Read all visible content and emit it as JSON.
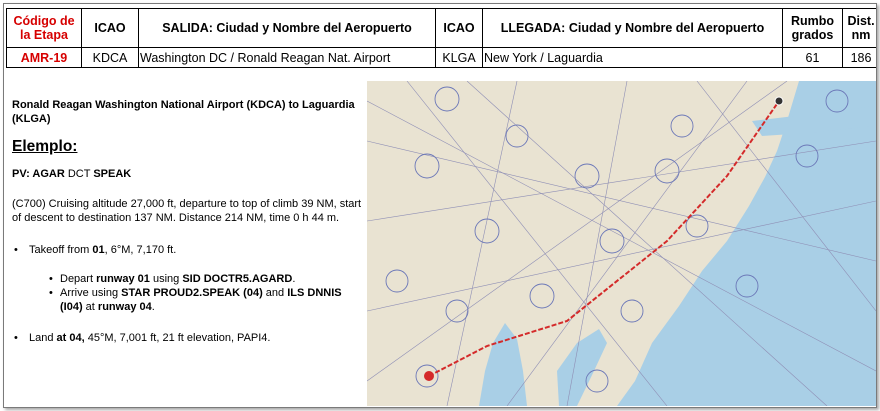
{
  "table": {
    "headers": {
      "code": "Código de la Etapa",
      "icao_dep": "ICAO",
      "departure": "SALIDA: Ciudad y Nombre del Aeropuerto",
      "icao_arr": "ICAO",
      "arrival": "LLEGADA: Ciudad y Nombre del Aeropuerto",
      "heading": "Rumbo grados",
      "distance": "Dist. nm"
    },
    "row": {
      "code": "AMR-19",
      "icao_dep": "KDCA",
      "departure": "Washington DC / Ronald Reagan Nat. Airport",
      "icao_arr": "KLGA",
      "arrival": "New York / Laguardia",
      "heading": "61",
      "distance": "186"
    }
  },
  "text": {
    "title": "Ronald Reagan Washington National Airport (KDCA) to Laguardia (KLGA)",
    "example": "Elemplo:",
    "pv_prefix": "PV: ",
    "pv_from": "AGAR",
    "pv_dct": " DCT ",
    "pv_to": "SPEAK",
    "plan": "(C700) Cruising altitude 27,000 ft, departure to top of climb 39 NM, start of descent to destination 137 NM. Distance 214 NM, time 0 h 44 m.",
    "takeoff_prefix": "Takeoff from ",
    "takeoff_runway": "01",
    "takeoff_suffix": ", 6°M, 7,170 ft.",
    "depart_prefix": "Depart ",
    "depart_runway": "runway 01",
    "depart_mid": " using ",
    "depart_sid": "SID DOCTR5.AGARD",
    "depart_end": ".",
    "arrive_prefix": "Arrive using ",
    "arrive_star": "STAR PROUD2.SPEAK (04)",
    "arrive_mid": " and ",
    "arrive_ils": "ILS DNNIS (I04)",
    "arrive_at": " at ",
    "arrive_runway": "runway 04",
    "arrive_end": ".",
    "land_prefix": "Land ",
    "land_at": "at 04,",
    "land_suffix": " 45°M, 7,001 ft, 21 ft elevation, PAPI4."
  },
  "map": {
    "land_color": "#e9e3d2",
    "water_color": "#a9cfe6",
    "route_color": "#d42a2a"
  }
}
